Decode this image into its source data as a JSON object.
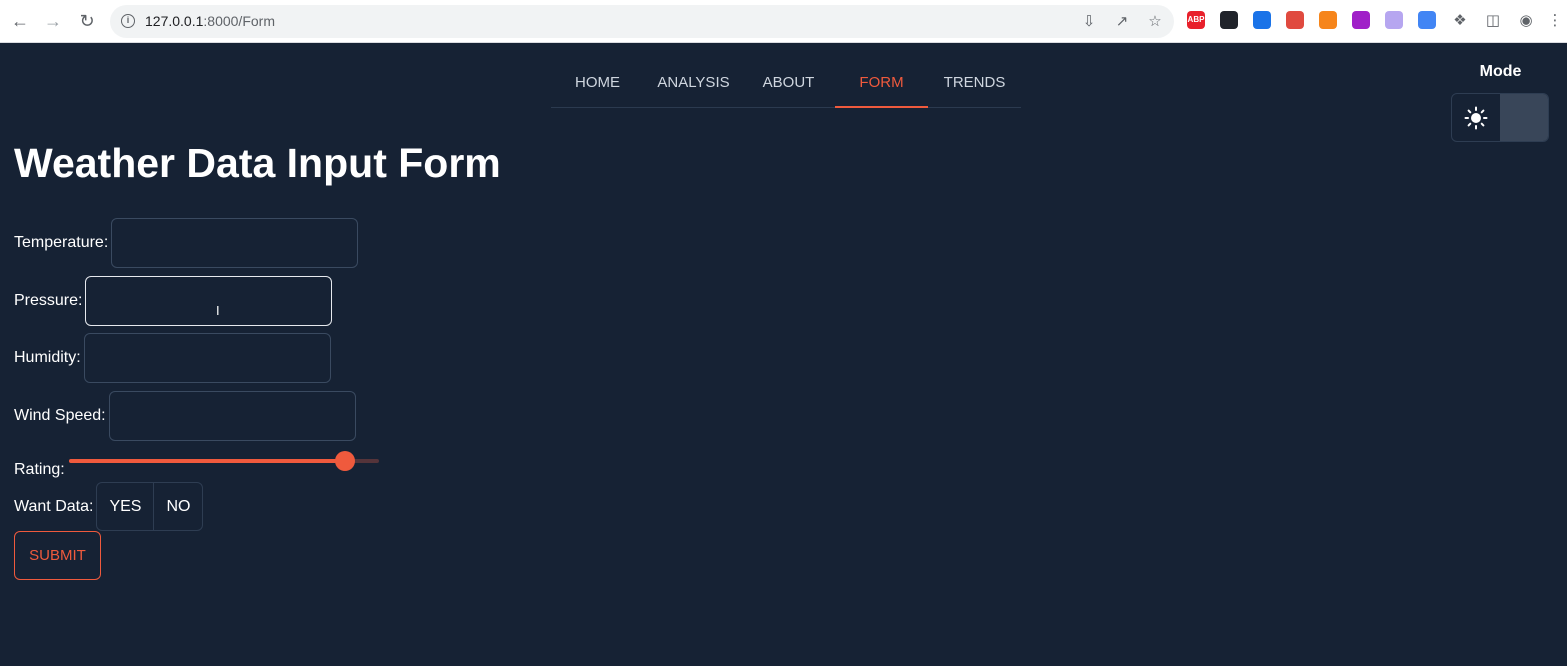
{
  "browser": {
    "url_host": "127.0.0.1",
    "url_rest": ":8000/Form",
    "extensions": [
      {
        "name": "adblock-icon",
        "label": "ABP",
        "color": "#e8202b"
      },
      {
        "name": "react-devtools-icon",
        "label": "",
        "color": "#20232a"
      },
      {
        "name": "shield-extension-icon",
        "label": "",
        "color": "#1a73e8"
      },
      {
        "name": "lock-extension-icon",
        "label": "",
        "color": "#e04a3f"
      },
      {
        "name": "metamask-fox-icon",
        "label": "",
        "color": "#f6851b"
      },
      {
        "name": "purple-square-icon",
        "label": "",
        "color": "#a020c8"
      },
      {
        "name": "cloud-extension-icon",
        "label": "",
        "color": "#b6a6f0"
      },
      {
        "name": "translate-icon",
        "label": "",
        "color": "#4285f4"
      }
    ]
  },
  "nav": {
    "items": [
      {
        "label": "HOME"
      },
      {
        "label": "ANALYSIS"
      },
      {
        "label": "ABOUT"
      },
      {
        "label": "FORM",
        "active": true
      },
      {
        "label": "TRENDS"
      }
    ]
  },
  "mode": {
    "label": "Mode",
    "selected": "dark"
  },
  "page": {
    "title": "Weather Data Input Form"
  },
  "form": {
    "temperature_label": "Temperature:",
    "temperature_value": "",
    "pressure_label": "Pressure:",
    "pressure_value": "",
    "humidity_label": "Humidity:",
    "humidity_value": "",
    "wind_label": "Wind Speed:",
    "wind_value": "",
    "rating_label": "Rating:",
    "rating_value": 0.89,
    "want_label": "Want Data:",
    "yes_label": "YES",
    "no_label": "NO",
    "submit_label": "SUBMIT"
  },
  "colors": {
    "accent": "#ef5a3d",
    "background": "#162234"
  }
}
